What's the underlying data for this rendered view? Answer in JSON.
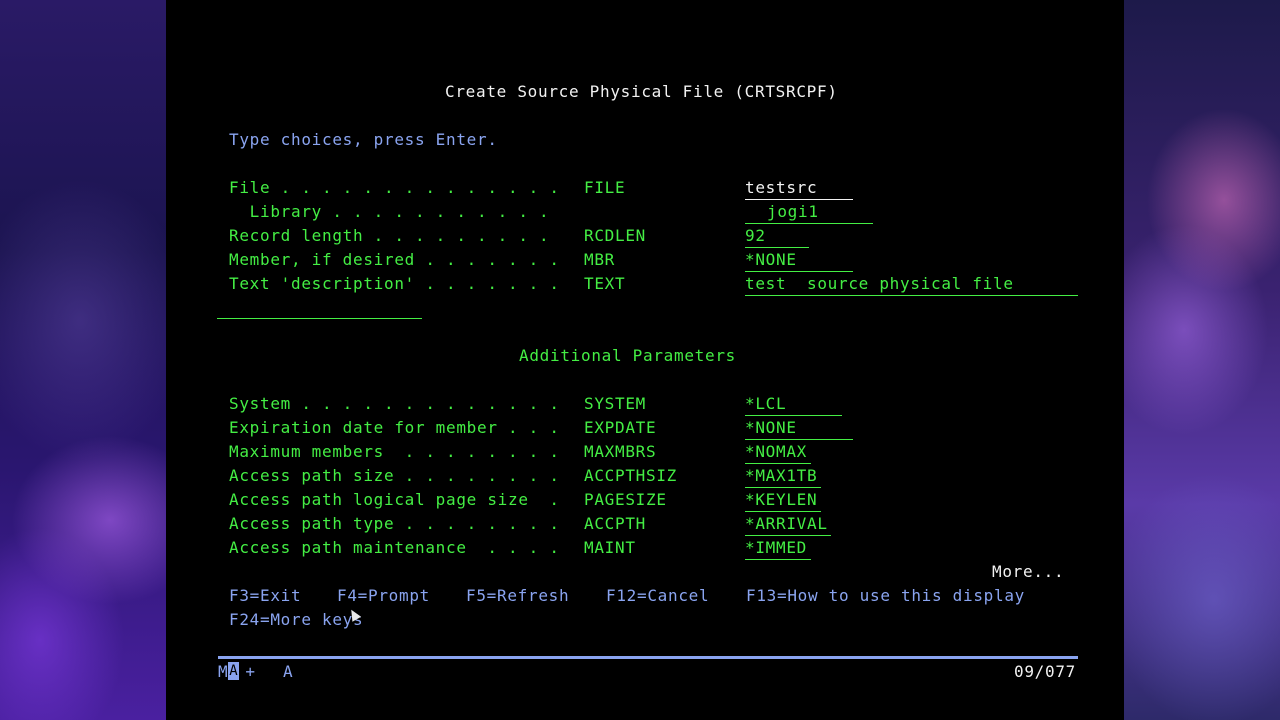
{
  "screen": {
    "title": "Create Source Physical File (CRTSRCPF)",
    "instructions": "Type choices, press Enter.",
    "main_params": [
      {
        "label": "File . . . . . . . . . . . . . .",
        "keyword": "FILE",
        "value": "testsrc"
      },
      {
        "label": "  Library . . . . . . . . . . .",
        "keyword": "",
        "value": "jogi1"
      },
      {
        "label": "Record length . . . . . . . . .",
        "keyword": "RCDLEN",
        "value": "92"
      },
      {
        "label": "Member, if desired . . . . . . .",
        "keyword": "MBR",
        "value": "*NONE"
      },
      {
        "label": "Text 'description' . . . . . . .",
        "keyword": "TEXT",
        "value": "test  source physical file"
      }
    ],
    "section_title": "Additional Parameters",
    "additional_params": [
      {
        "label": "System . . . . . . . . . . . . .",
        "keyword": "SYSTEM",
        "value": "*LCL"
      },
      {
        "label": "Expiration date for member . . .",
        "keyword": "EXPDATE",
        "value": "*NONE"
      },
      {
        "label": "Maximum members  . . . . . . . .",
        "keyword": "MAXMBRS",
        "value": "*NOMAX"
      },
      {
        "label": "Access path size . . . . . . . .",
        "keyword": "ACCPTHSIZ",
        "value": "*MAX1TB"
      },
      {
        "label": "Access path logical page size  .",
        "keyword": "PAGESIZE",
        "value": "*KEYLEN"
      },
      {
        "label": "Access path type . . . . . . . .",
        "keyword": "ACCPTH",
        "value": "*ARRIVAL"
      },
      {
        "label": "Access path maintenance  . . . .",
        "keyword": "MAINT",
        "value": "*IMMED"
      }
    ],
    "more": "More...",
    "function_keys": [
      "F3=Exit",
      "F4=Prompt",
      "F5=Refresh",
      "F12=Cancel",
      "F13=How to use this display",
      "F24=More keys"
    ]
  },
  "status_bar": {
    "prefix": "M",
    "cursor_char": "A",
    "indicator": "+",
    "mode": "A",
    "position": "09/077"
  },
  "colors": {
    "field_green": "#44ee44",
    "text_white": "#f2f2f2",
    "text_blue": "#8aa4f0",
    "background": "#000000"
  }
}
